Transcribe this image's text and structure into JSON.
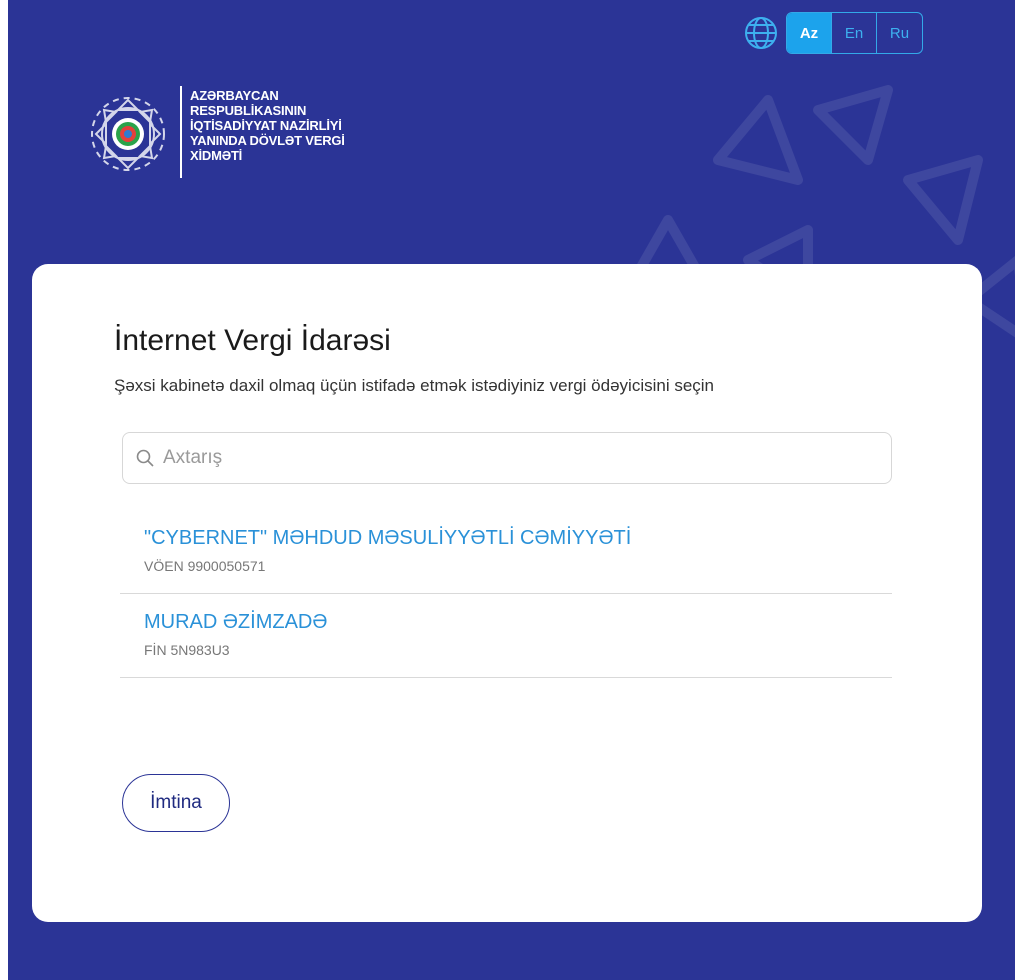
{
  "header": {
    "org_lines": [
      "AZƏRBAYCAN",
      "RESPUBLİKASININ",
      "İQTİSADİYYAT NAZİRLİYİ",
      "YANINDA DÖVLƏT VERGİ",
      "XİDMƏTİ"
    ],
    "languages": [
      "Az",
      "En",
      "Ru"
    ],
    "active_language": "Az"
  },
  "card": {
    "title": "İnternet Vergi İdarəsi",
    "subtitle": "Şəxsi kabinetə daxil olmaq üçün istifadə etmək istədiyiniz vergi ödəyicisini seçin",
    "search_placeholder": "Axtarış",
    "taxpayers": [
      {
        "name": "\"CYBERNET\" MƏHDUD MƏSULİYYƏTLİ CƏMİYYƏTİ",
        "id": "VÖEN 9900050571"
      },
      {
        "name": "MURAD ƏZİMZADƏ",
        "id": "FİN 5N983U3"
      }
    ],
    "cancel_label": "İmtina"
  },
  "colors": {
    "background": "#2b3496",
    "accent": "#1ca3ec",
    "link": "#2a91d8"
  },
  "icons": [
    "globe-icon",
    "state-emblem-logo",
    "search-icon"
  ]
}
